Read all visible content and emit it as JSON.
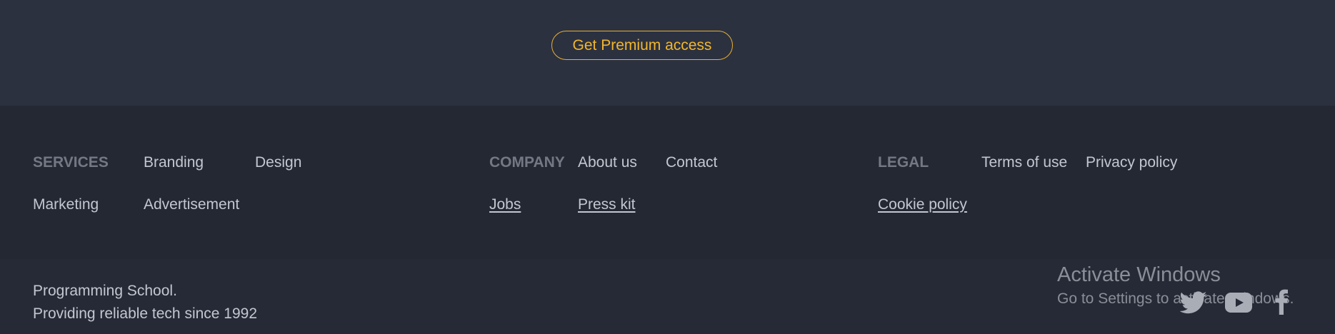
{
  "cta": {
    "premium_label": "Get Premium access"
  },
  "footer": {
    "services": {
      "heading": "SERVICES",
      "links": [
        "Branding",
        "Design",
        "Marketing",
        "Advertisement"
      ]
    },
    "company": {
      "heading": "COMPANY",
      "links": [
        "About us",
        "Contact",
        "Jobs",
        "Press kit"
      ]
    },
    "legal": {
      "heading": "LEGAL",
      "links": [
        "Terms of use",
        "Privacy policy",
        "Cookie policy"
      ]
    },
    "tagline": {
      "line1": "Programming School.",
      "line2": "Providing reliable tech since 1992"
    },
    "social": [
      "twitter-icon",
      "youtube-icon",
      "facebook-icon"
    ]
  },
  "windows_watermark": {
    "title": "Activate Windows",
    "subtitle": "Go to Settings to activate Windows."
  },
  "colors": {
    "accent": "#f2b62c",
    "background": "#252935",
    "cta_background": "#2c313f",
    "heading": "#737884",
    "text": "#c3c7d0"
  }
}
